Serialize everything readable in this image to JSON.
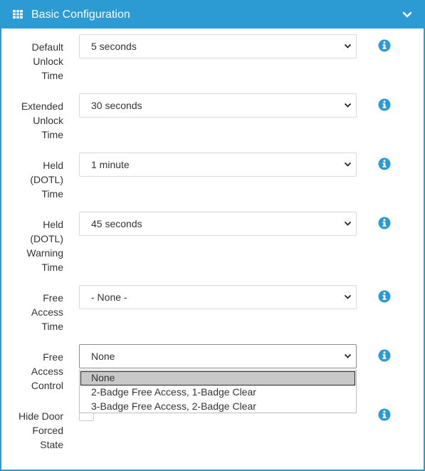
{
  "panel": {
    "title": "Basic Configuration",
    "header_icon": "table-icon",
    "collapse_icon": "chevron-down-icon",
    "accent_color": "#2c9ad3"
  },
  "fields": [
    {
      "label": "Default Unlock Time",
      "label_lines": [
        "Default",
        "Unlock",
        "Time"
      ],
      "value": "5 seconds"
    },
    {
      "label": "Extended Unlock Time",
      "label_lines": [
        "Extended",
        "Unlock",
        "Time"
      ],
      "value": "30 seconds"
    },
    {
      "label": "Held (DOTL) Time",
      "label_lines": [
        "Held",
        "(DOTL)",
        "Time"
      ],
      "value": "1 minute"
    },
    {
      "label": "Held (DOTL) Warning Time",
      "label_lines": [
        "Held",
        "(DOTL)",
        "Warning",
        "Time"
      ],
      "value": "45 seconds"
    },
    {
      "label": "Free Access Time",
      "label_lines": [
        "Free",
        "Access",
        "Time"
      ],
      "value": "- None -"
    },
    {
      "label": "Free Access Control",
      "label_lines": [
        "Free",
        "Access",
        "Control"
      ],
      "value": "None"
    },
    {
      "label": "Hide Door Forced State",
      "label_lines": [
        "Hide Door",
        "Forced",
        "State"
      ],
      "value": ""
    }
  ],
  "free_access_control_dropdown": {
    "options": [
      "None",
      "2-Badge Free Access, 1-Badge Clear",
      "3-Badge Free Access, 2-Badge Clear"
    ],
    "highlighted": "None"
  },
  "info_icon": "info-circle-icon",
  "info_color": "#2c9ad3"
}
